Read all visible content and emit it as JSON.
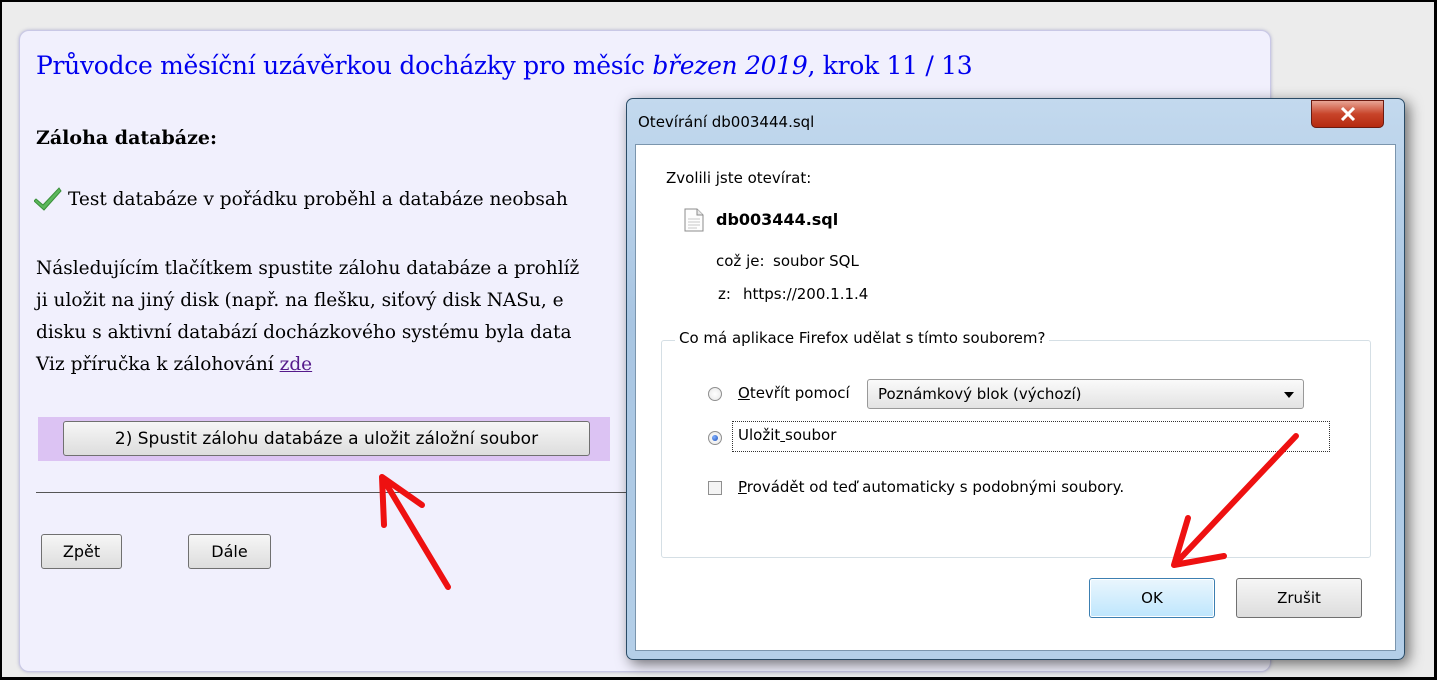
{
  "wizard": {
    "title_prefix": "Průvodce měsíční uzávěrkou docházky pro měsíc ",
    "title_month": "březen 2019",
    "title_suffix": ", krok 11 / 13",
    "section_heading": "Záloha databáze:",
    "status_text": "Test databáze v pořádku proběhl a databáze neobsah",
    "para_line1": "Následujícím tlačítkem spustite zálohu databáze a prohlíž",
    "para_line2": "ji uložit na jiný disk (např. na flešku, siťový disk NASu, e",
    "para_line3": "disku s aktivní databází docházkového systému byla data",
    "para_line4_prefix": "Viz příručka k zálohování ",
    "para_link": "zde",
    "backup_button": "2) Spustit zálohu databáze a uložit záložní soubor",
    "back_button": "Zpět",
    "next_button": "Dále"
  },
  "dialog": {
    "title": "Otevírání db003444.sql",
    "close_label": "x",
    "intro": "Zvolili jste otevírat:",
    "filename": "db003444.sql",
    "type_label": "což je:",
    "type_value": "soubor SQL",
    "from_label": "z:",
    "from_value": "https://200.1.1.4",
    "question": "Co má aplikace Firefox udělat s tímto souborem?",
    "open_with_label": "Otevřít pomocí",
    "open_with_value": "Poznámkový blok (výchozí)",
    "save_label": "Uložit soubor",
    "auto_label": "Provádět od teď automaticky s podobnými soubory.",
    "selected_option": "save",
    "auto_checked": false,
    "ok_button": "OK",
    "cancel_button": "Zrušit"
  },
  "colors": {
    "annotation_arrow": "#ee1111",
    "title_link": "#0000ee",
    "button_strip": "#dcc3f3",
    "check_icon": "#4caf50"
  }
}
